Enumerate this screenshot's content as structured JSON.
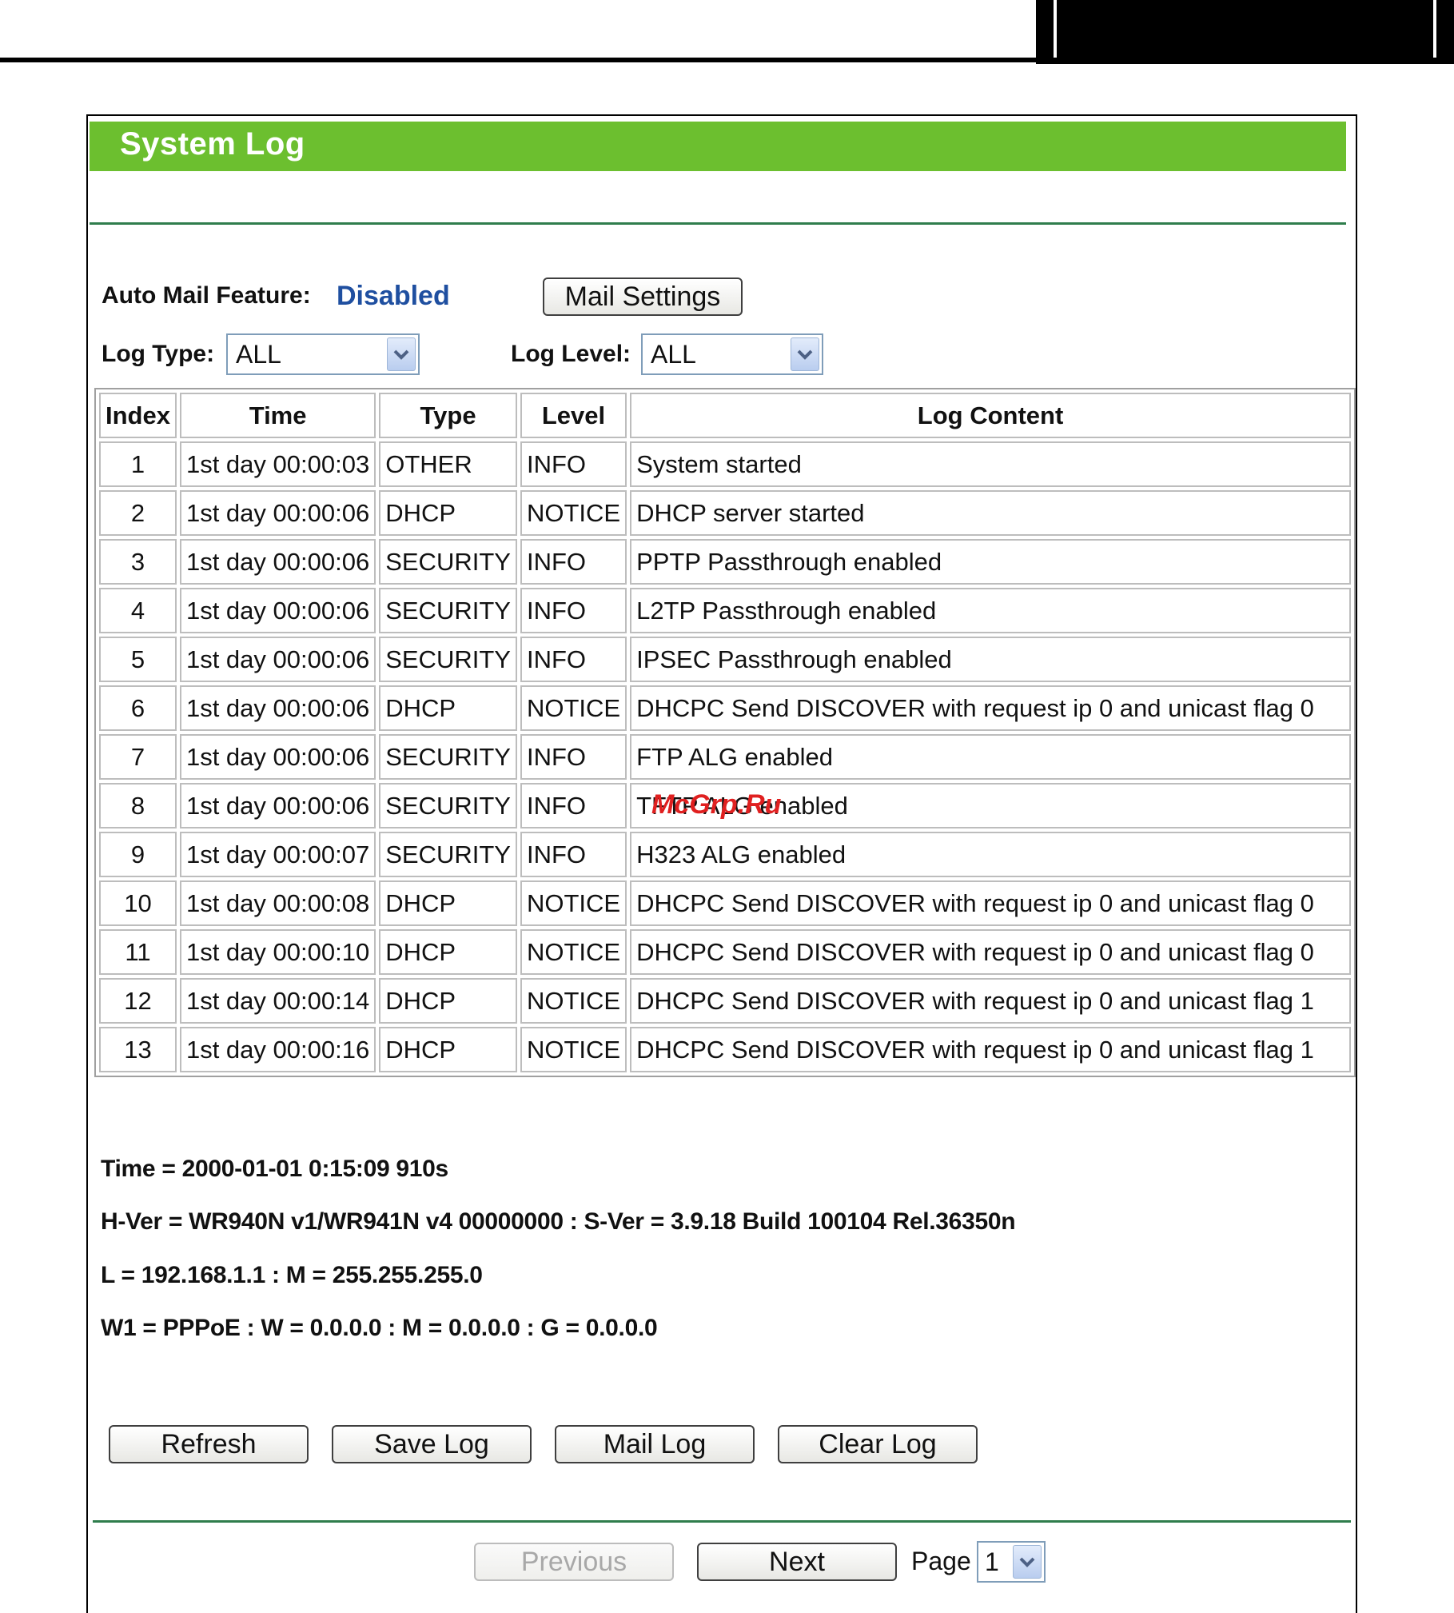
{
  "page": {
    "title": "System Log"
  },
  "mail": {
    "auto_mail_label": "Auto Mail Feature:",
    "auto_mail_value": "Disabled",
    "mail_settings_button": "Mail Settings"
  },
  "filters": {
    "log_type_label": "Log Type:",
    "log_type_value": "ALL",
    "log_level_label": "Log Level:",
    "log_level_value": "ALL"
  },
  "table": {
    "headers": [
      "Index",
      "Time",
      "Type",
      "Level",
      "Log Content"
    ],
    "rows": [
      {
        "index": "1",
        "time": "1st day 00:00:03",
        "type": "OTHER",
        "level": "INFO",
        "content": "System started"
      },
      {
        "index": "2",
        "time": "1st day 00:00:06",
        "type": "DHCP",
        "level": "NOTICE",
        "content": "DHCP server started"
      },
      {
        "index": "3",
        "time": "1st day 00:00:06",
        "type": "SECURITY",
        "level": "INFO",
        "content": "PPTP Passthrough enabled"
      },
      {
        "index": "4",
        "time": "1st day 00:00:06",
        "type": "SECURITY",
        "level": "INFO",
        "content": "L2TP Passthrough enabled"
      },
      {
        "index": "5",
        "time": "1st day 00:00:06",
        "type": "SECURITY",
        "level": "INFO",
        "content": "IPSEC Passthrough enabled"
      },
      {
        "index": "6",
        "time": "1st day 00:00:06",
        "type": "DHCP",
        "level": "NOTICE",
        "content": "DHCPC Send DISCOVER with request ip 0 and unicast flag 0"
      },
      {
        "index": "7",
        "time": "1st day 00:00:06",
        "type": "SECURITY",
        "level": "INFO",
        "content": "FTP ALG enabled"
      },
      {
        "index": "8",
        "time": "1st day 00:00:06",
        "type": "SECURITY",
        "level": "INFO",
        "content": "TFTP ALG enabled"
      },
      {
        "index": "9",
        "time": "1st day 00:00:07",
        "type": "SECURITY",
        "level": "INFO",
        "content": "H323 ALG enabled"
      },
      {
        "index": "10",
        "time": "1st day 00:00:08",
        "type": "DHCP",
        "level": "NOTICE",
        "content": "DHCPC Send DISCOVER with request ip 0 and unicast flag 0"
      },
      {
        "index": "11",
        "time": "1st day 00:00:10",
        "type": "DHCP",
        "level": "NOTICE",
        "content": "DHCPC Send DISCOVER with request ip 0 and unicast flag 0"
      },
      {
        "index": "12",
        "time": "1st day 00:00:14",
        "type": "DHCP",
        "level": "NOTICE",
        "content": "DHCPC Send DISCOVER with request ip 0 and unicast flag 1"
      },
      {
        "index": "13",
        "time": "1st day 00:00:16",
        "type": "DHCP",
        "level": "NOTICE",
        "content": "DHCPC Send DISCOVER with request ip 0 and unicast flag 1"
      }
    ]
  },
  "watermark": "McGrp.Ru",
  "info": {
    "time": "Time = 2000-01-01 0:15:09 910s",
    "version": "H-Ver = WR940N v1/WR941N v4 00000000 : S-Ver = 3.9.18 Build 100104 Rel.36350n",
    "lan": "L = 192.168.1.1 : M = 255.255.255.0",
    "wan": "W1 = PPPoE : W = 0.0.0.0 : M = 0.0.0.0 : G = 0.0.0.0"
  },
  "actions": {
    "refresh": "Refresh",
    "save_log": "Save Log",
    "mail_log": "Mail Log",
    "clear_log": "Clear Log"
  },
  "pagination": {
    "previous": "Previous",
    "next": "Next",
    "page_label": "Page",
    "page_value": "1"
  },
  "colors": {
    "title_bar": "#6cbf2f",
    "separator": "#2f7d4c",
    "disabled_value": "#1f4fa0",
    "watermark": "#e02020"
  }
}
